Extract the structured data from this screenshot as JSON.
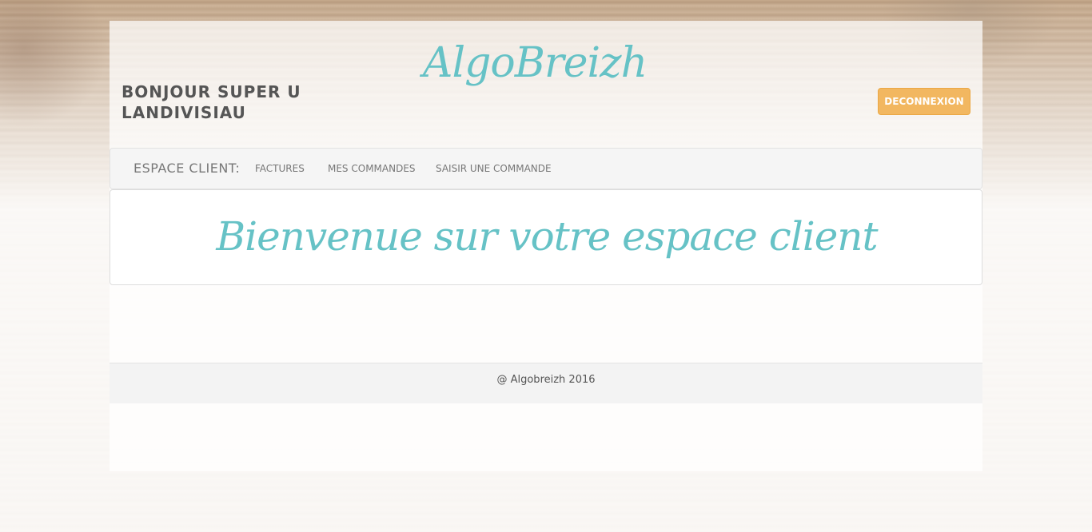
{
  "header": {
    "greeting": "BONJOUR SUPER U LANDIVISIAU",
    "logo_text": "AlgoBreizh",
    "logout_label": "DECONNEXION"
  },
  "nav": {
    "brand": "ESPACE CLIENT:",
    "links": [
      "FACTURES",
      "MES COMMANDES",
      "SAISIR UNE COMMANDE"
    ]
  },
  "main": {
    "welcome": "Bienvenue sur votre espace client"
  },
  "footer": {
    "text": "@ Algobreizh 2016"
  },
  "colors": {
    "accent": "#66c2c6",
    "button": "#f2b760",
    "text": "#555555"
  }
}
